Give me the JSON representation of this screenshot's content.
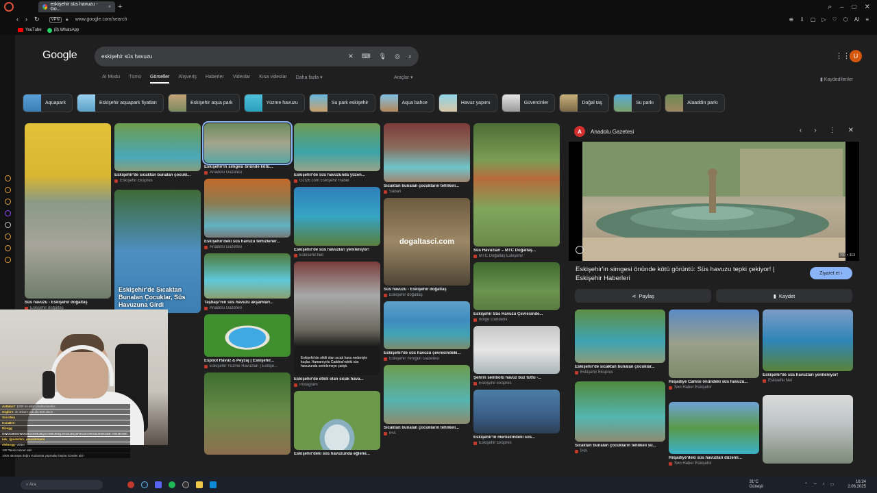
{
  "browser": {
    "tab_title": "eskişehir süs havuzu - Go...",
    "url": "www.google.com/search",
    "vpn": "VPN",
    "bookmarks": [
      "YouTube",
      "(8) WhatsApp"
    ],
    "ai_label": "AI"
  },
  "google": {
    "logo": "Google",
    "query": "eskişehir süs havuzu",
    "avatar_letter": "U",
    "tabs": [
      "AI Modu",
      "Tümü",
      "Görseller",
      "Alışveriş",
      "Haberler",
      "Videolar",
      "Kısa videolar",
      "Daha fazla"
    ],
    "tools": "Araçlar",
    "saved": "Kaydedilenler",
    "chips": [
      "Aquapark",
      "Eskişehir aquapark fiyatları",
      "Eskişehir aqua park",
      "Yüzme havuzu",
      "Su park eskişehir",
      "Aqua bahce",
      "Havuz yapımı",
      "Güvercinler",
      "Doğal taş",
      "Su parkı",
      "Alaaddin parkı"
    ]
  },
  "results": [
    {
      "cap": "Süs havuzu - Eskişehir doğaltaş",
      "src": "Eskişehir doğaltaş"
    },
    {
      "cap": "Eskişehir'de sıcaktan bunalan çocukl...",
      "src": "Eskişehir Ekspres"
    },
    {
      "cap": "Eskişehir'de sıcaktan bunalan çocuk...",
      "src": ""
    },
    {
      "cap": "havuzuna...",
      "src": ""
    },
    {
      "cap": "Eskişehir'in simgesi önünde kötü...",
      "src": "Anadolu Gazetesi"
    },
    {
      "cap": "Eskişehir'deki süs havuzu temizlener...",
      "src": "Anadolu Gazetesi"
    },
    {
      "cap": "Taşbaşı'nın süs havuzu akşamları...",
      "src": "Anadolu Gazetesi"
    },
    {
      "cap": "Espool Havuz & Peyzaj | Eskişehir...",
      "src": "Eskişehir Yüzme Havuzları | Eskişe..."
    },
    {
      "cap": "Eskişehir'de süs havuzunda yüzen...",
      "src": "Gzt26.com Eskişehir Haber"
    },
    {
      "cap": "Eskişehir'de süs havuzları yenileniyor!",
      "src": "Eskisehir.Net"
    },
    {
      "cap": "Eskişehir'de etkili olan sıcak hava...",
      "src": "Instagram"
    },
    {
      "cap": "Eskişehir'deki süs havuzunda eğlene...",
      "src": ""
    },
    {
      "cap": "Sıcaktan bunalan çocukların tehlikeli...",
      "src": "Sabah"
    },
    {
      "cap": "Süs havuzu - Eskişehir doğaltaş",
      "src": "Eskişehir doğaltaş"
    },
    {
      "cap": "Eskişehir'de süs havuzu çevresindeki...",
      "src": "Eskişehir Yenigün Gazetesi"
    },
    {
      "cap": "Sıcaktan bunalan çocukların tehlikeli...",
      "src": "İHA"
    },
    {
      "cap": "Süs Havuzları – MTC Doğaltaş...",
      "src": "MTC Doğaltaş Eskişehir"
    },
    {
      "cap": "Eskişehir Süs Havuzu Çevresinde...",
      "src": "Bölge Gündemi"
    },
    {
      "cap": "Şehrin sembolü havuz buz tuttu -...",
      "src": "Eskişehir Ekspres"
    },
    {
      "cap": "Eskişehir'in merkezindeki süs...",
      "src": "Eskişehir Ekspres"
    }
  ],
  "overlay_texts": {
    "dogaltas": "dogaltasci.com",
    "sicaktan": "Eskişehir'de Sıcaktan Bunalan Çocuklar, Süs Havuzuna Girdi",
    "news_text": "Eskişehir'de etkili olan sıcak hava nedeniyle kuşlar, Hamamyolu Caddesi'ndeki süs havuzunda serinlemeye çalıştı."
  },
  "panel": {
    "source": "Anadolu Gazetesi",
    "logo_letter": "A",
    "dims": "700 × 313",
    "title": "Eskişehir'in simgesi önünde kötü görüntü: Süs havuzu tepki çekiyor! | Eskişehir Haberleri",
    "visit": "Ziyaret et",
    "share": "Paylaş",
    "save": "Kaydet",
    "related": [
      {
        "cap": "Eskişehir'de sıcaktan bunalan çocuklar...",
        "src": "Eskişehir Ekspres"
      },
      {
        "cap": "Reşadiye Camisi önündeki süs havuzu...",
        "src": "Son Haber Eskişehir"
      },
      {
        "cap": "Eskişehir'de süs havuzları yenileniyor!",
        "src": "Eskisehir.Net"
      },
      {
        "cap": "Sıcaktan bunalan çocukların tehlikeli sü...",
        "src": "İHA"
      },
      {
        "cap": "Reşadiye'deki süs havuzları düzenli...",
        "src": "Son Haber Eskişehir"
      },
      {
        "cap": "",
        "src": ""
      }
    ]
  },
  "chat": [
    {
      "u": "AntMan7",
      "t": "1000 ne abim dedikodutekis"
    },
    {
      "u": "Orgbire",
      "t": "1k imkanı yok abi 500 olsun"
    },
    {
      "u": "SoccBey",
      "t": ""
    },
    {
      "u": "KaraBen",
      "t": ""
    },
    {
      "u": "Rizegg",
      "t": ""
    },
    {
      "u": "",
      "t": "OWOOIIIOOWOOIIOOHIIIJIIQGOWIIJIIIIQJOGIIJEQWOIIJEOWOIIIJEWOIDE OWJEOW!"
    },
    {
      "u": "kek_rjpoiterkrn_amaslerkami",
      "t": ""
    },
    {
      "u": "eleknrgg",
      "t": "Video"
    },
    {
      "u": "",
      "t": "100 Takiki minner abi!"
    },
    {
      "u": "",
      "t": "1000 abonaya doğru Kodossta yapmalar başlıa Gönder abi !"
    }
  ],
  "taskbar": {
    "search": "Ara",
    "temp": "31°C",
    "weather": "Güneşli",
    "time": "16:24",
    "date": "2.06.2025"
  }
}
